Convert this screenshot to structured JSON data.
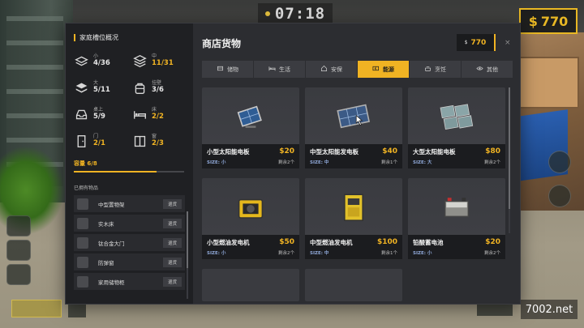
{
  "hud": {
    "timer": "07:18",
    "money_symbol": "$",
    "money": "770",
    "watermark": "7002.net"
  },
  "colors": {
    "accent": "#f0b323",
    "panel": "#2c2d31",
    "panel_dark": "#1f2023",
    "size_text": "#8fa8d8"
  },
  "left_panel": {
    "title": "家庭槽位概况",
    "slots": [
      {
        "icon": "stack-small-icon",
        "label": "小",
        "count": "4/36",
        "highlight": false
      },
      {
        "icon": "stack-medium-icon",
        "label": "中",
        "count": "11/31",
        "highlight": true
      },
      {
        "icon": "stack-large-icon",
        "label": "大",
        "count": "5/11",
        "highlight": false
      },
      {
        "icon": "backpack-icon",
        "label": "挂壁",
        "count": "3/6",
        "highlight": false
      },
      {
        "icon": "tray-icon",
        "label": "桌上",
        "count": "5/9",
        "highlight": false
      },
      {
        "icon": "bed-icon",
        "label": "床",
        "count": "2/2",
        "highlight": true
      },
      {
        "icon": "door-icon",
        "label": "门",
        "count": "2/1",
        "highlight": true
      },
      {
        "icon": "window-icon",
        "label": "窗",
        "count": "2/3",
        "highlight": true
      }
    ],
    "capacity_label": "容量 6/8",
    "capacity_fraction": 0.75,
    "owned_title": "已拥有物品",
    "owned_items": [
      {
        "name": "中型置物架",
        "action": "退货"
      },
      {
        "name": "实木床",
        "action": "退货"
      },
      {
        "name": "钛合金大门",
        "action": "退货"
      },
      {
        "name": "防弹窗",
        "action": "退货"
      },
      {
        "name": "家用储物柜",
        "action": "退货"
      }
    ]
  },
  "shop": {
    "title": "商店货物",
    "money_symbol": "$",
    "money": "770",
    "close": "×",
    "tabs": [
      {
        "label": "储物",
        "icon": "storage-icon",
        "active": false
      },
      {
        "label": "生活",
        "icon": "bed-icon",
        "active": false
      },
      {
        "label": "安保",
        "icon": "house-icon",
        "active": false
      },
      {
        "label": "能源",
        "icon": "battery-icon",
        "active": true
      },
      {
        "label": "烹饪",
        "icon": "cooking-icon",
        "active": false
      },
      {
        "label": "其他",
        "icon": "eye-icon",
        "active": false
      }
    ],
    "items": [
      {
        "name": "小型太阳能电板",
        "price": "$20",
        "size": "SIZE: 小",
        "stock": "剩余2个",
        "icon": "solar-panel-small-icon"
      },
      {
        "name": "中型太阳能发电板",
        "price": "$40",
        "size": "SIZE: 中",
        "stock": "剩余1个",
        "icon": "solar-panel-medium-icon"
      },
      {
        "name": "大型太阳能电板",
        "price": "$80",
        "size": "SIZE: 大",
        "stock": "剩余2个",
        "icon": "solar-panel-large-icon"
      },
      {
        "name": "小型燃油发电机",
        "price": "$50",
        "size": "SIZE: 小",
        "stock": "剩余2个",
        "icon": "generator-small-icon"
      },
      {
        "name": "中型燃油发电机",
        "price": "$100",
        "size": "SIZE: 中",
        "stock": "剩余1个",
        "icon": "generator-medium-icon"
      },
      {
        "name": "铅酸蓄电池",
        "price": "$20",
        "size": "SIZE: 小",
        "stock": "剩余2个",
        "icon": "battery-icon"
      }
    ]
  }
}
